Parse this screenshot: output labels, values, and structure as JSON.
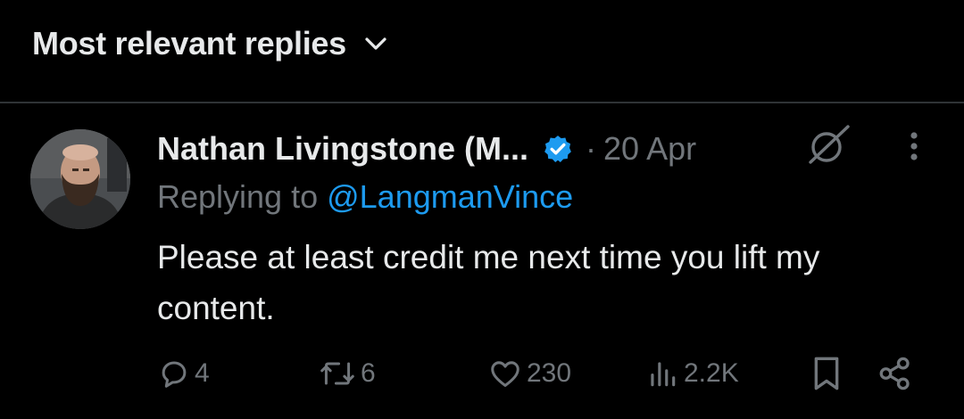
{
  "header": {
    "sort_label": "Most relevant replies"
  },
  "reply": {
    "author_name": "Nathan Livingstone (M...",
    "separator": "·",
    "timestamp": "20 Apr",
    "replying_prefix": "Replying to ",
    "replying_handle": "@LangmanVince",
    "text": "Please at least credit me next time you lift my content.",
    "actions": {
      "replies": "4",
      "reposts": "6",
      "likes": "230",
      "views": "2.2K"
    }
  },
  "colors": {
    "background": "#000000",
    "primary_text": "#e7e9ea",
    "secondary_text": "#71767b",
    "accent": "#1d9bf0",
    "divider": "#2f3336"
  }
}
